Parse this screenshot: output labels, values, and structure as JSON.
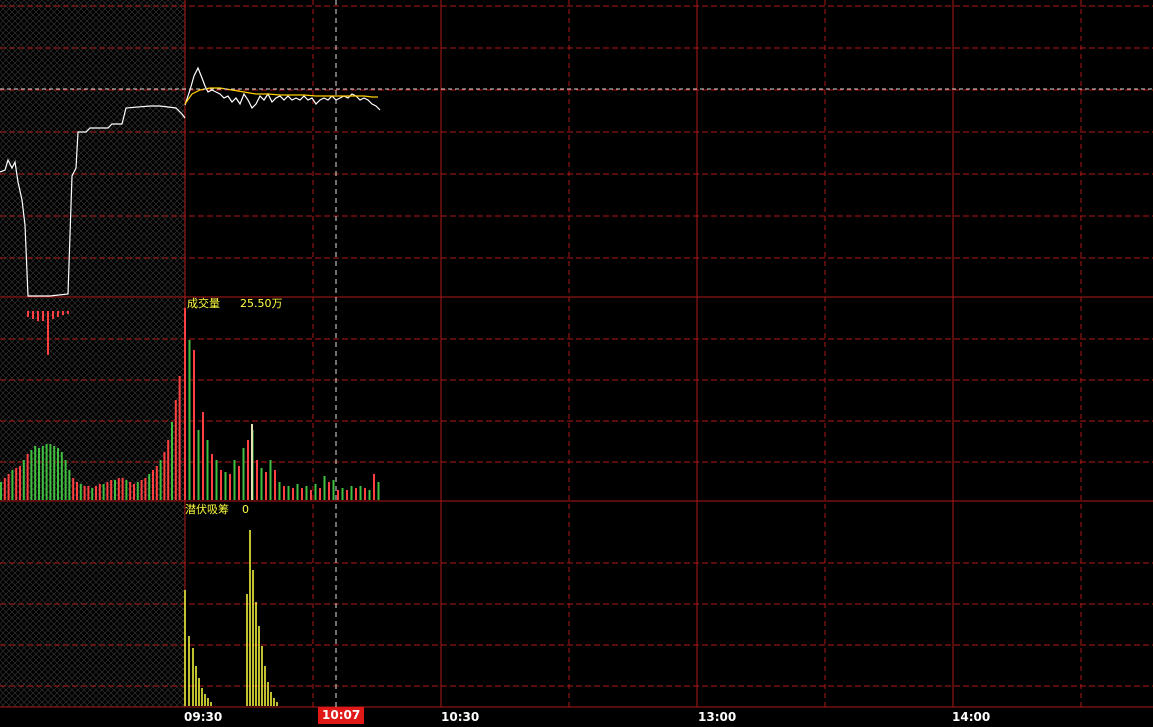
{
  "volume_panel": {
    "label": "成交量",
    "value": "25.50万"
  },
  "indicator_panel": {
    "label": "潜伏吸筹",
    "value": "0"
  },
  "time_axis": {
    "labels": [
      "09:30",
      "10:30",
      "13:00",
      "14:00"
    ],
    "cursor_time": "10:07"
  },
  "colors": {
    "grid": "#b01818",
    "price_line": "#ffffff",
    "avg_line": "#ffd000",
    "volume_up": "#ff4040",
    "volume_down": "#40c040",
    "indicator_bar": "#ffff40",
    "cursor_badge": "#e01818"
  }
}
